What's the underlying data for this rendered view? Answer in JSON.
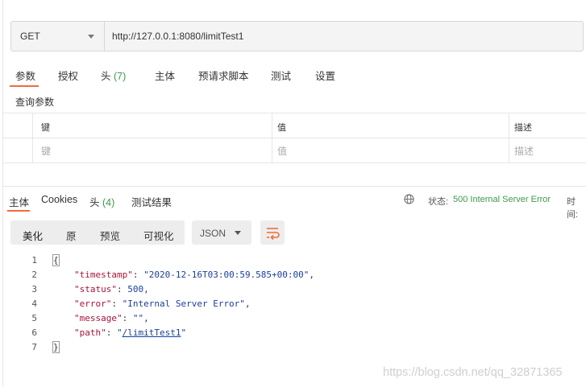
{
  "request": {
    "method": "GET",
    "url": "http://127.0.0.1:8080/limitTest1"
  },
  "request_tabs": [
    {
      "label": "参数"
    },
    {
      "label": "授权"
    },
    {
      "label": "头",
      "count": "(7)"
    },
    {
      "label": "主体"
    },
    {
      "label": "预请求脚本"
    },
    {
      "label": "测试"
    },
    {
      "label": "设置"
    }
  ],
  "query_params": {
    "title": "查询参数",
    "headers": [
      "键",
      "值",
      "描述"
    ],
    "placeholders": [
      "键",
      "值",
      "描述"
    ]
  },
  "response_tabs": [
    {
      "label": "主体"
    },
    {
      "label": "Cookies"
    },
    {
      "label": "头",
      "count": "(4)"
    },
    {
      "label": "测试结果"
    }
  ],
  "status": {
    "label": "状态:",
    "value": "500 Internal Server Error",
    "time_label": "时间:"
  },
  "view_modes": [
    "美化",
    "原",
    "预览",
    "可视化"
  ],
  "format": "JSON",
  "response_body": {
    "line_numbers": [
      "1",
      "2",
      "3",
      "4",
      "5",
      "6",
      "7"
    ],
    "open_brace": "{",
    "close_brace": "}",
    "fields": [
      {
        "key": "\"timestamp\"",
        "value": "\"2020-12-16T03:00:59.585+00:00\"",
        "sep": ","
      },
      {
        "key": "\"status\"",
        "value": "500",
        "sep": ","
      },
      {
        "key": "\"error\"",
        "value": "\"Internal Server Error\"",
        "sep": ","
      },
      {
        "key": "\"message\"",
        "value": "\"\"",
        "sep": ","
      },
      {
        "key": "\"path\"",
        "value_q": "\"",
        "value_link": "/limitTest1",
        "value_q2": "\"",
        "sep": ""
      }
    ]
  },
  "watermark": "https://blog.csdn.net/qq_32871365",
  "colors": {
    "accent": "#f26b3a",
    "success": "#3c9a4a",
    "json_key": "#a8143a",
    "json_value": "#1a3f99"
  }
}
